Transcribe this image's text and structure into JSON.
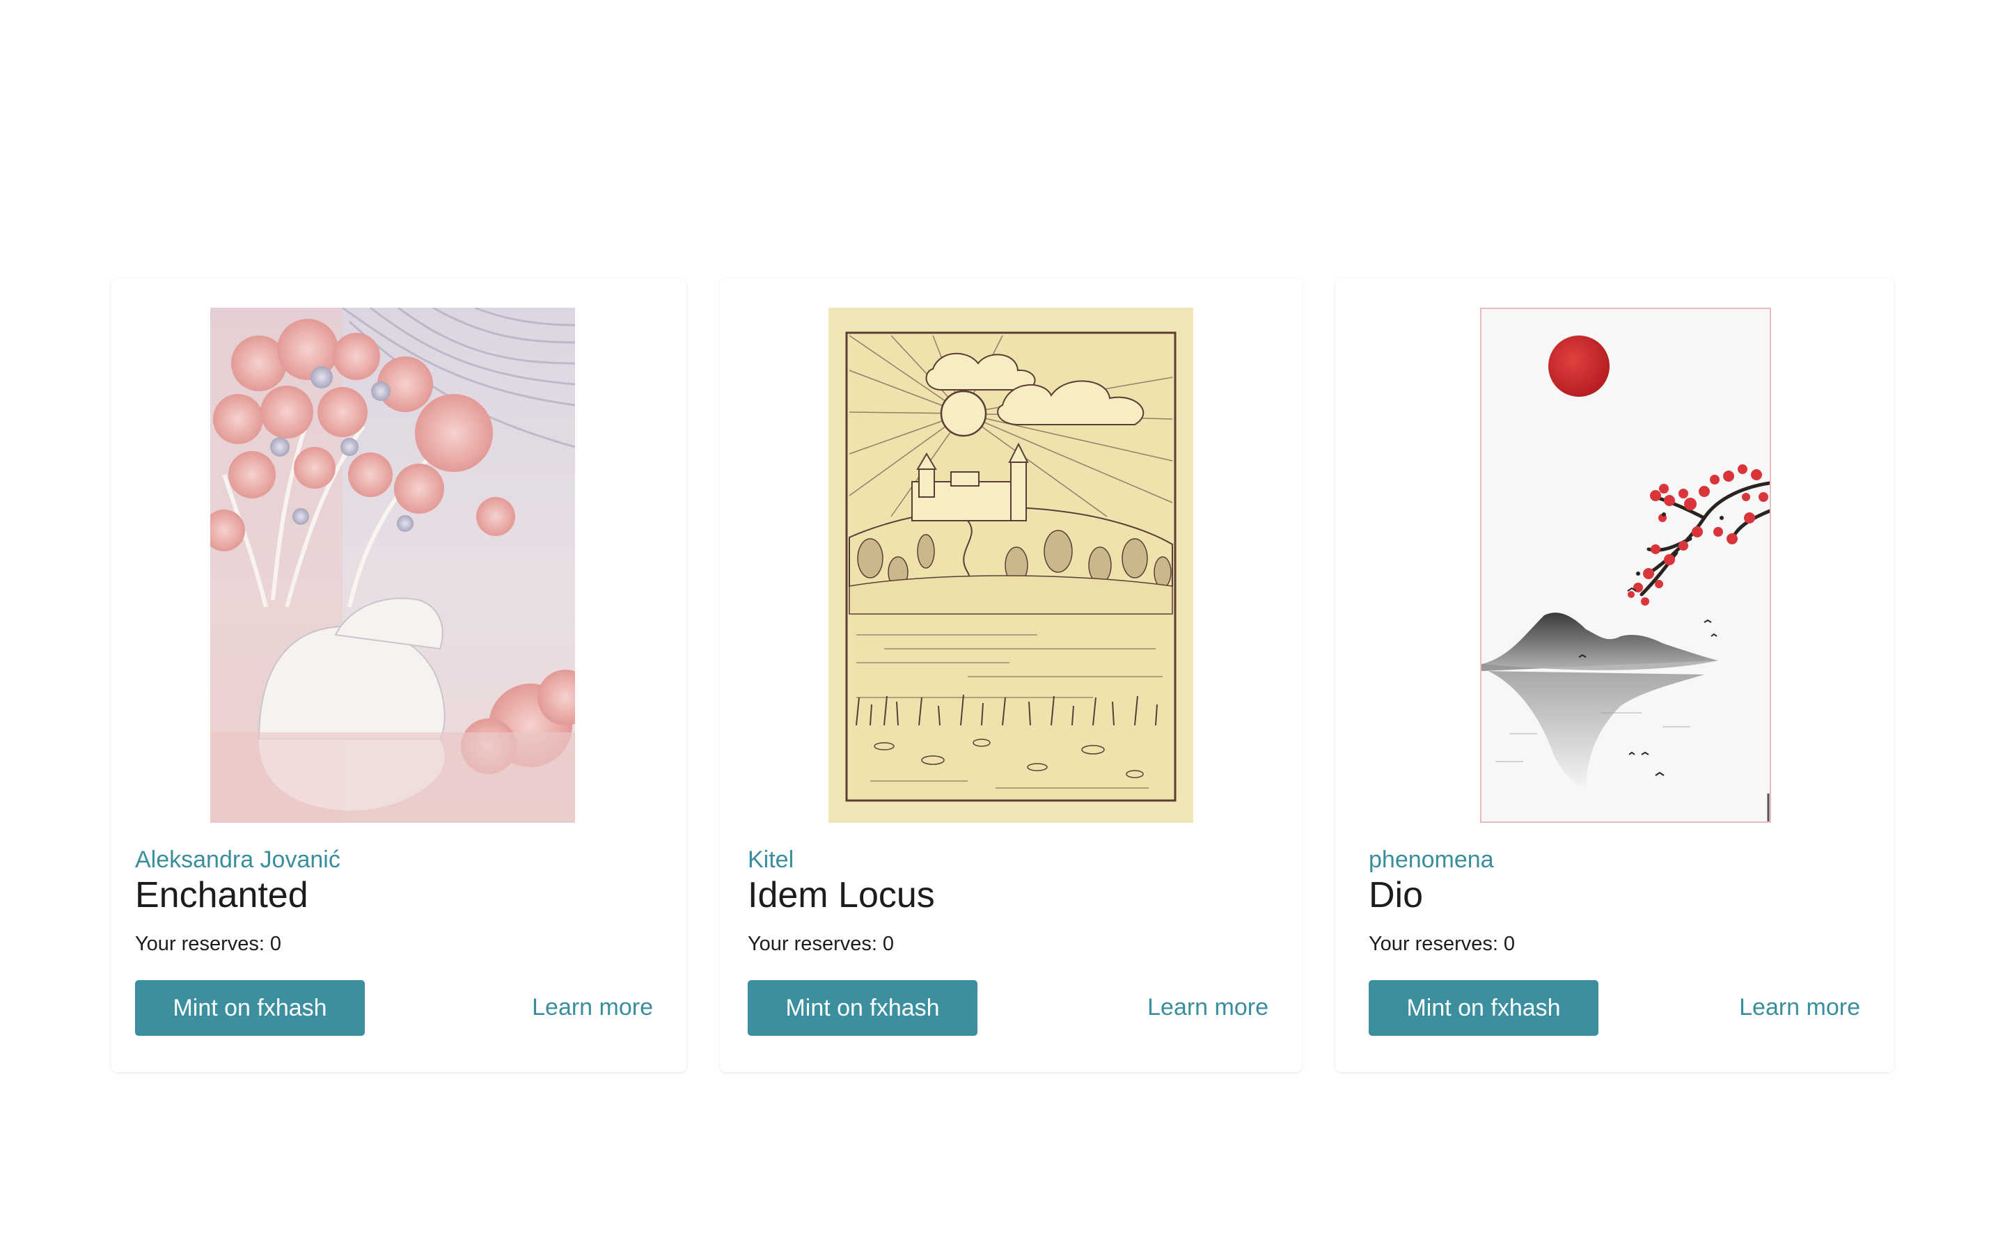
{
  "cards": [
    {
      "artist": "Aleksandra Jovanić",
      "title": "Enchanted",
      "reserves_label": "Your reserves:",
      "reserves_value": "0",
      "mint_label": "Mint on fxhash",
      "learn_label": "Learn more",
      "accent": "#3a8e9c"
    },
    {
      "artist": "Kitel",
      "title": "Idem Locus",
      "reserves_label": "Your reserves:",
      "reserves_value": "0",
      "mint_label": "Mint on fxhash",
      "learn_label": "Learn more",
      "accent": "#3a8e9c"
    },
    {
      "artist": "phenomena",
      "title": "Dio",
      "reserves_label": "Your reserves:",
      "reserves_value": "0",
      "mint_label": "Mint on fxhash",
      "learn_label": "Learn more",
      "accent": "#3a8e9c"
    }
  ],
  "colors": {
    "button_bg": "#3c8f9e",
    "link": "#3a8e9c",
    "text": "#1c1c1c"
  }
}
